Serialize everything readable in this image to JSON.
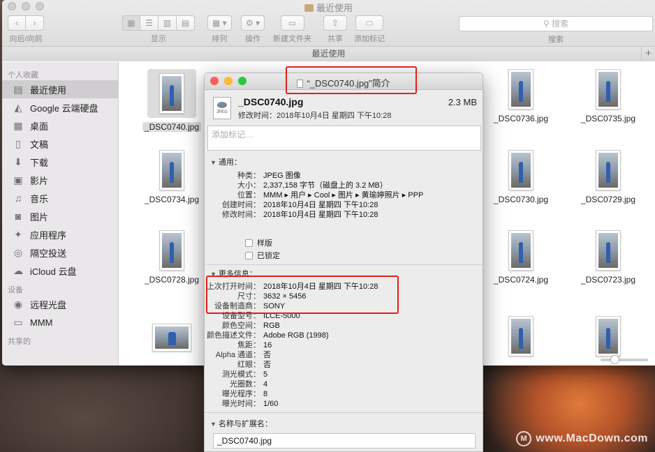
{
  "desktop": {
    "watermark": "www.MacDown.com"
  },
  "finder": {
    "title": "最近使用",
    "toolbar": {
      "nav_label": "向后/向前",
      "view_label": "显示",
      "arrange_label": "排列",
      "action_label": "操作",
      "newfolder_label": "新建文件夹",
      "share_label": "共享",
      "tags_label": "添加标记",
      "search_placeholder": "搜索",
      "search_label": "搜索"
    },
    "path_title": "最近使用",
    "sidebar": {
      "favorites_header": "个人收藏",
      "favorites": [
        {
          "label": "最近使用",
          "icon": "recents-icon",
          "glyph": "▤"
        },
        {
          "label": "Google 云端硬盘",
          "icon": "google-drive-icon",
          "glyph": "◭"
        },
        {
          "label": "桌面",
          "icon": "desktop-icon",
          "glyph": "▦"
        },
        {
          "label": "文稿",
          "icon": "documents-icon",
          "glyph": "▯"
        },
        {
          "label": "下载",
          "icon": "downloads-icon",
          "glyph": "⬇"
        },
        {
          "label": "影片",
          "icon": "movies-icon",
          "glyph": "▣"
        },
        {
          "label": "音乐",
          "icon": "music-icon",
          "glyph": "♫"
        },
        {
          "label": "图片",
          "icon": "pictures-icon",
          "glyph": "◙"
        },
        {
          "label": "应用程序",
          "icon": "applications-icon",
          "glyph": "✦"
        },
        {
          "label": "隔空投送",
          "icon": "airdrop-icon",
          "glyph": "◎"
        },
        {
          "label": "iCloud 云盘",
          "icon": "icloud-icon",
          "glyph": "☁"
        }
      ],
      "devices_header": "设备",
      "devices": [
        {
          "label": "远程光盘",
          "icon": "remote-disc-icon",
          "glyph": "◉"
        },
        {
          "label": "MMM",
          "icon": "disk-icon",
          "glyph": "▭"
        }
      ],
      "shared_header": "共享的"
    },
    "files": [
      {
        "name": "_DSC0740.jpg",
        "selected": true
      },
      {
        "name": "_DSC0736.jpg"
      },
      {
        "name": "_DSC0735.jpg"
      },
      {
        "name": "_DSC0734.jpg"
      },
      {
        "name": "_DSC0730.jpg"
      },
      {
        "name": "_DSC0729.jpg"
      },
      {
        "name": "_DSC0728.jpg"
      },
      {
        "name": "_DSC0724.jpg"
      },
      {
        "name": "_DSC0723.jpg"
      }
    ]
  },
  "info": {
    "window_title": "“_DSC0740.jpg”简介",
    "file_name": "_DSC0740.jpg",
    "file_size": "2.3 MB",
    "modified_line": "修改时间：2018年10月4日 星期四 下午10:28",
    "icon_caption": "JPEG",
    "tags_placeholder": "添加标记…",
    "general_header": "通用：",
    "general": [
      {
        "k": "种类：",
        "v": "JPEG 图像"
      },
      {
        "k": "大小：",
        "v": "2,337,158 字节（磁盘上的 3.2 MB）"
      },
      {
        "k": "位置：",
        "v": "MMM ▸ 用户 ▸ Cool ▸ 图片 ▸ 黄瑜婷照片 ▸ PPP"
      },
      {
        "k": "创建时间：",
        "v": "2018年10月4日 星期四 下午10:28"
      },
      {
        "k": "修改时间：",
        "v": "2018年10月4日 星期四 下午10:28"
      }
    ],
    "stationery_label": "样版",
    "locked_label": "已锁定",
    "more_header": "更多信息：",
    "more": [
      {
        "k": "上次打开时间：",
        "v": "2018年10月4日 星期四 下午10:28"
      },
      {
        "k": "尺寸：",
        "v": "3632 × 5456"
      },
      {
        "k": "设备制造商：",
        "v": "SONY"
      },
      {
        "k": "设备型号：",
        "v": "ILCE-5000"
      },
      {
        "k": "颜色空间：",
        "v": "RGB"
      },
      {
        "k": "颜色描述文件：",
        "v": "Adobe RGB (1998)"
      },
      {
        "k": "焦距：",
        "v": "16"
      },
      {
        "k": "Alpha 通道：",
        "v": "否"
      },
      {
        "k": "红眼：",
        "v": "否"
      },
      {
        "k": "测光模式：",
        "v": "5"
      },
      {
        "k": "光圈数：",
        "v": "4"
      },
      {
        "k": "曝光程序：",
        "v": "8"
      },
      {
        "k": "曝光时间：",
        "v": "1/60"
      }
    ],
    "name_header": "名称与扩展名：",
    "name_value": "_DSC0740.jpg"
  },
  "colors": {
    "highlight": "#e0201b",
    "close": "#fc5f57",
    "minimize": "#fdbc2e",
    "zoom": "#28c840"
  }
}
